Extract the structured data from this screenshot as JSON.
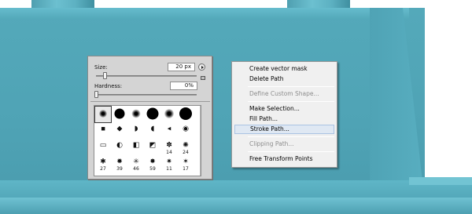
{
  "brush_panel": {
    "size_label": "Size:",
    "size_value": "20 px",
    "hardness_label": "Hardness:",
    "hardness_value": "0%",
    "presets": [
      {
        "style": "soft",
        "d": 10,
        "num": "",
        "selected": true
      },
      {
        "style": "hard",
        "d": 13,
        "num": ""
      },
      {
        "style": "soft",
        "d": 11,
        "num": ""
      },
      {
        "style": "hard",
        "d": 15,
        "num": ""
      },
      {
        "style": "soft",
        "d": 12,
        "num": ""
      },
      {
        "style": "hard",
        "d": 16,
        "num": ""
      },
      {
        "style": "glyph",
        "g": "▪",
        "num": ""
      },
      {
        "style": "glyph",
        "g": "◆",
        "num": ""
      },
      {
        "style": "glyph",
        "g": "◗",
        "num": ""
      },
      {
        "style": "glyph",
        "g": "◖",
        "num": ""
      },
      {
        "style": "glyph",
        "g": "◂",
        "num": ""
      },
      {
        "style": "glyph",
        "g": "◉",
        "num": ""
      },
      {
        "style": "glyph",
        "g": "▭",
        "num": ""
      },
      {
        "style": "glyph",
        "g": "◐",
        "num": ""
      },
      {
        "style": "glyph",
        "g": "◧",
        "num": ""
      },
      {
        "style": "glyph",
        "g": "◩",
        "num": ""
      },
      {
        "style": "glyph",
        "g": "✽",
        "num": "14"
      },
      {
        "style": "glyph",
        "g": "✺",
        "num": "24"
      },
      {
        "style": "glyph",
        "g": "✱",
        "num": "27"
      },
      {
        "style": "glyph",
        "g": "✹",
        "num": "39"
      },
      {
        "style": "glyph",
        "g": "✳",
        "num": "46"
      },
      {
        "style": "glyph",
        "g": "✸",
        "num": "59"
      },
      {
        "style": "glyph",
        "g": "✷",
        "num": "11"
      },
      {
        "style": "glyph",
        "g": "✶",
        "num": "17"
      }
    ],
    "icons": {
      "flyout": "flyout-arrow-icon",
      "new_preset": "new-preset-icon"
    }
  },
  "context_menu": {
    "items": [
      {
        "label": "Create vector mask",
        "enabled": true
      },
      {
        "label": "Delete Path",
        "enabled": true
      },
      {
        "sep": true
      },
      {
        "label": "Define Custom Shape...",
        "enabled": false
      },
      {
        "sep": true
      },
      {
        "label": "Make Selection...",
        "enabled": true
      },
      {
        "label": "Fill Path...",
        "enabled": true
      },
      {
        "label": "Stroke Path...",
        "enabled": true,
        "highlighted": true
      },
      {
        "sep": true
      },
      {
        "label": "Clipping Path...",
        "enabled": false
      },
      {
        "sep": true
      },
      {
        "label": "Free Transform Points",
        "enabled": true
      }
    ]
  },
  "colors": {
    "artwork_teal": "#4fa3b5",
    "panel_bg": "#d4d4d4",
    "menu_bg": "#f0f0f0",
    "menu_highlight": "#dfe8f3"
  }
}
